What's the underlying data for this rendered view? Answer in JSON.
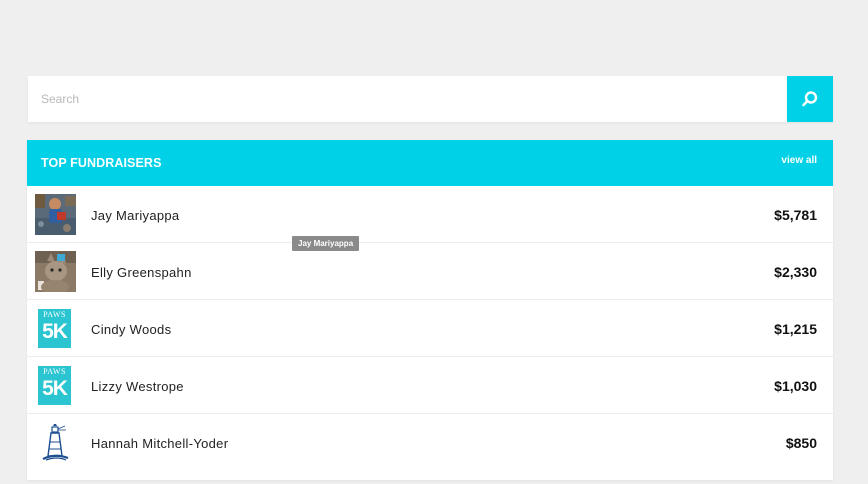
{
  "search": {
    "placeholder": "Search"
  },
  "panel": {
    "title": "TOP FUNDRAISERS",
    "view_all": "view all"
  },
  "fundraisers": [
    {
      "name": "Jay Mariyappa",
      "amount": "$5,781",
      "avatar": "photo-person"
    },
    {
      "name": "Elly Greenspahn",
      "amount": "$2,330",
      "avatar": "photo-cat"
    },
    {
      "name": "Cindy Woods",
      "amount": "$1,215",
      "avatar": "paws-5k-logo"
    },
    {
      "name": "Lizzy Westrope",
      "amount": "$1,030",
      "avatar": "paws-5k-logo"
    },
    {
      "name": "Hannah Mitchell-Yoder",
      "amount": "$850",
      "avatar": "lighthouse-logo"
    }
  ],
  "tooltip": {
    "text": "Jay Mariyappa"
  },
  "logos": {
    "paws_word": "PAWS",
    "paws_5k": "5K"
  },
  "colors": {
    "accent": "#00d1e6",
    "background": "#efefef"
  }
}
